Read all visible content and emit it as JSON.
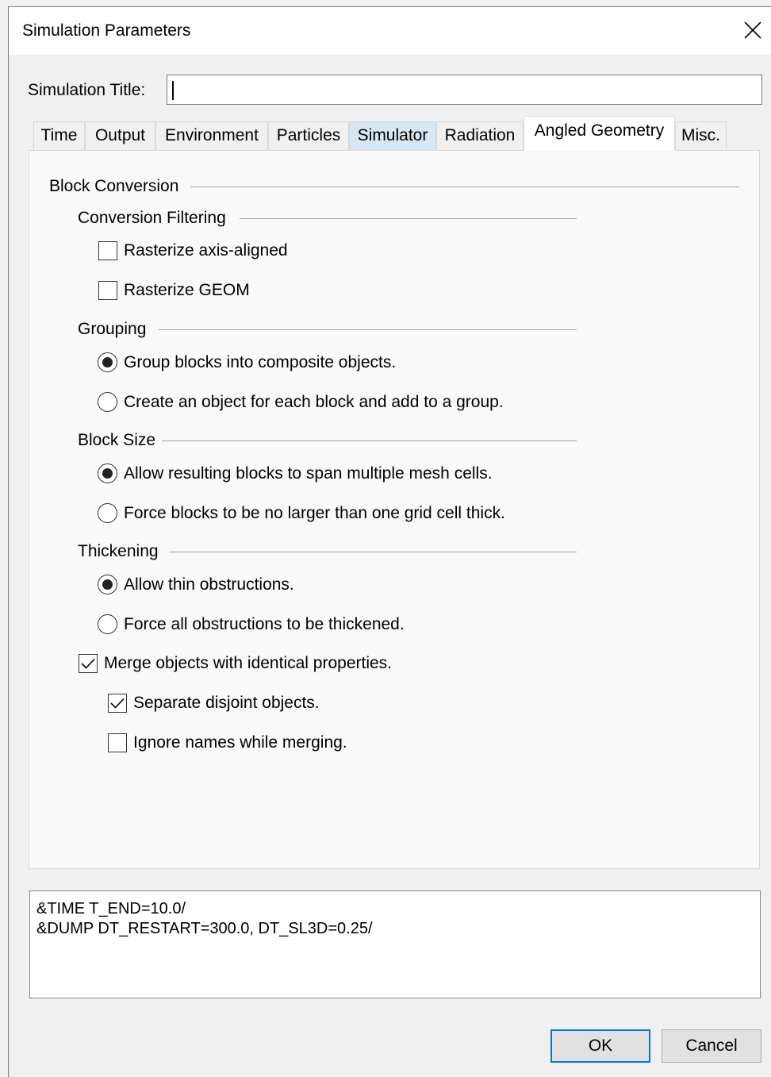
{
  "window": {
    "title": "Simulation Parameters"
  },
  "form": {
    "title_label": "Simulation Title:",
    "title_value": "",
    "title_placeholder": ""
  },
  "tabs": [
    {
      "label": "Time"
    },
    {
      "label": "Output"
    },
    {
      "label": "Environment"
    },
    {
      "label": "Particles"
    },
    {
      "label": "Simulator"
    },
    {
      "label": "Radiation"
    },
    {
      "label": "Angled Geometry"
    },
    {
      "label": "Misc."
    }
  ],
  "active_tab": "Angled Geometry",
  "hover_tab": "Simulator",
  "panel": {
    "block_conversion": "Block Conversion",
    "conversion_filtering": {
      "header": "Conversion Filtering",
      "rasterize_axis_aligned": {
        "label": "Rasterize axis-aligned",
        "checked": false
      },
      "rasterize_geom": {
        "label": "Rasterize GEOM",
        "checked": false
      }
    },
    "grouping": {
      "header": "Grouping",
      "options": [
        {
          "label": "Group blocks into composite objects.",
          "selected": true
        },
        {
          "label": "Create an object for each block and add to a group.",
          "selected": false
        }
      ]
    },
    "block_size": {
      "header": "Block Size",
      "options": [
        {
          "label": "Allow resulting blocks to span multiple mesh cells.",
          "selected": true
        },
        {
          "label": "Force blocks to be no larger than one grid cell thick.",
          "selected": false
        }
      ]
    },
    "thickening": {
      "header": "Thickening",
      "options": [
        {
          "label": "Allow thin obstructions.",
          "selected": true
        },
        {
          "label": "Force all obstructions to be thickened.",
          "selected": false
        }
      ]
    },
    "merge": {
      "label": "Merge objects with identical properties.",
      "checked": true,
      "separate_disjoint": {
        "label": "Separate disjoint objects.",
        "checked": true
      },
      "ignore_names": {
        "label": "Ignore names while merging.",
        "checked": false
      }
    }
  },
  "namelist_lines": [
    "&TIME T_END=10.0/",
    "&DUMP DT_RESTART=300.0, DT_SL3D=0.25/"
  ],
  "buttons": {
    "ok": "OK",
    "cancel": "Cancel"
  }
}
